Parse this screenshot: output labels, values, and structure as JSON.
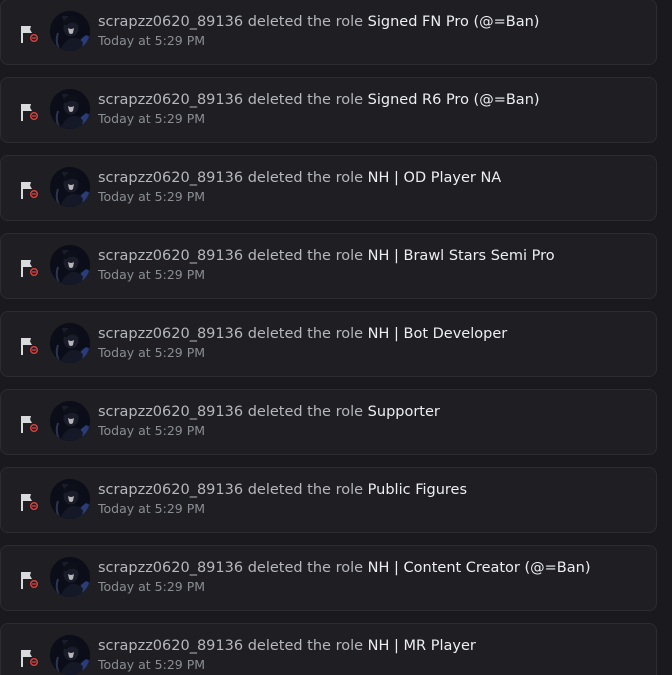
{
  "audit_log": {
    "entries": [
      {
        "username": "scrapzz0620_89136",
        "action": "deleted the role",
        "role": "Signed FN Pro (@=Ban)",
        "time": "Today at 5:29 PM"
      },
      {
        "username": "scrapzz0620_89136",
        "action": "deleted the role",
        "role": "Signed R6 Pro (@=Ban)",
        "time": "Today at 5:29 PM"
      },
      {
        "username": "scrapzz0620_89136",
        "action": "deleted the role",
        "role": "NH | OD Player NA",
        "time": "Today at 5:29 PM"
      },
      {
        "username": "scrapzz0620_89136",
        "action": "deleted the role",
        "role": "NH | Brawl Stars Semi Pro",
        "time": "Today at 5:29 PM"
      },
      {
        "username": "scrapzz0620_89136",
        "action": "deleted the role",
        "role": "NH | Bot Developer",
        "time": "Today at 5:29 PM"
      },
      {
        "username": "scrapzz0620_89136",
        "action": "deleted the role",
        "role": "Supporter",
        "time": "Today at 5:29 PM"
      },
      {
        "username": "scrapzz0620_89136",
        "action": "deleted the role",
        "role": "Public Figures",
        "time": "Today at 5:29 PM"
      },
      {
        "username": "scrapzz0620_89136",
        "action": "deleted the role",
        "role": "NH | Content Creator (@=Ban)",
        "time": "Today at 5:29 PM"
      },
      {
        "username": "scrapzz0620_89136",
        "action": "deleted the role",
        "role": "NH | MR Player",
        "time": "Today at 5:29 PM"
      }
    ],
    "icons": {
      "entry_icon": "flag-delete-icon",
      "avatar": "user-avatar"
    },
    "colors": {
      "background": "#1a1a1e",
      "entry_background": "#1f1f23",
      "delete_badge": "#e0413f",
      "role_text": "#eceef1",
      "muted_text": "#8a8d93"
    }
  }
}
